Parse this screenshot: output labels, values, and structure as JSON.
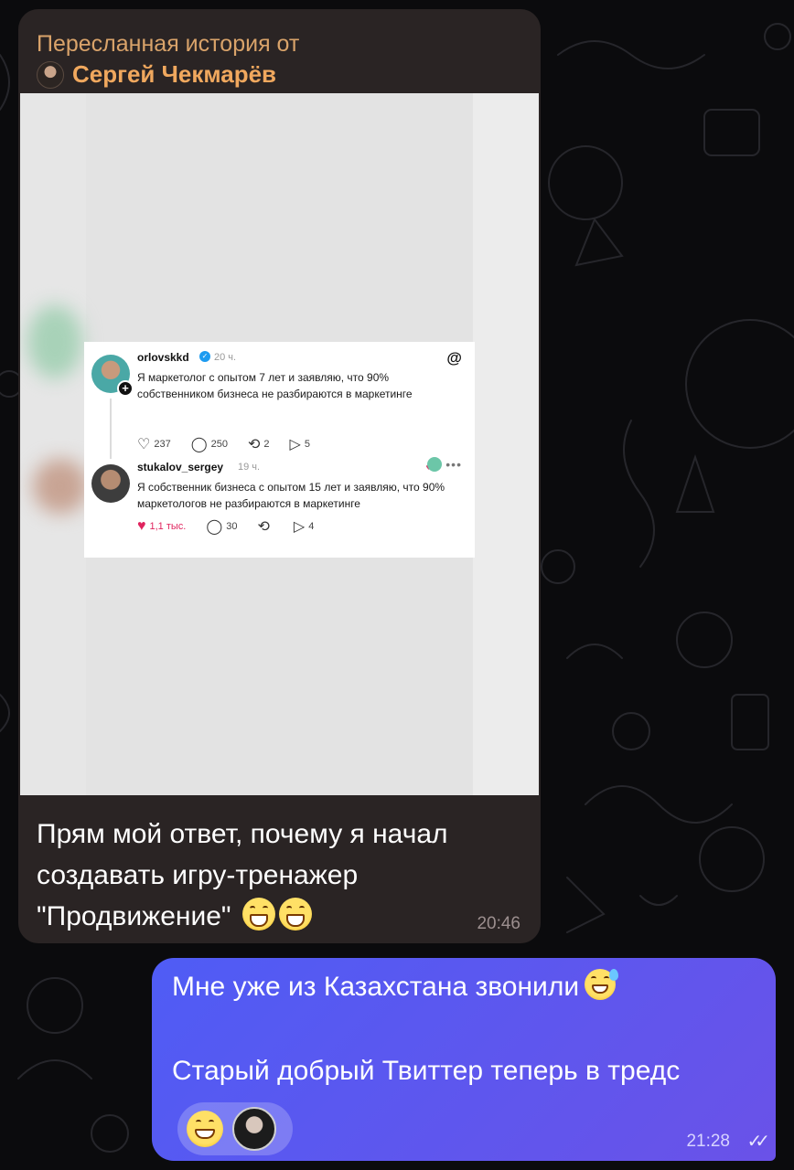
{
  "chat": {
    "forwarded": {
      "label": "Пересланная история от",
      "author": "Сергей Чекмарёв",
      "caption": "Прям мой ответ, почему я начал создавать игру-тренажер \"Продвижение\"",
      "time": "20:46",
      "story": {
        "posts": [
          {
            "username": "orlovskkd",
            "time": "20 ч.",
            "text": "Я маркетолог с опытом 7 лет и заявляю, что 90% собственником бизнеса не разбираются в маркетинге",
            "likes": "237",
            "comments": "250",
            "reposts": "2",
            "shares": "5"
          },
          {
            "username": "stukalov_sergey",
            "time": "19 ч.",
            "text": "Я собственник бизнеса с опытом 15 лет и заявляю, что 90% маркетологов не разбираются в маркетинге",
            "likes": "1,1 тыс.",
            "comments": "30",
            "shares": "4"
          }
        ]
      }
    },
    "outgoing": {
      "line1": "Мне уже из Казахстана звонили",
      "line2": "Старый добрый Твиттер теперь в тредс",
      "time": "21:28",
      "status_icon": "double-check-icon"
    }
  },
  "colors": {
    "incoming_bubble": "#2a2424",
    "forward_label": "#d9a36a",
    "outgoing_bubble_start": "#4f5cf5",
    "outgoing_bubble_end": "#6a52e8",
    "background": "#0b0b0d"
  }
}
